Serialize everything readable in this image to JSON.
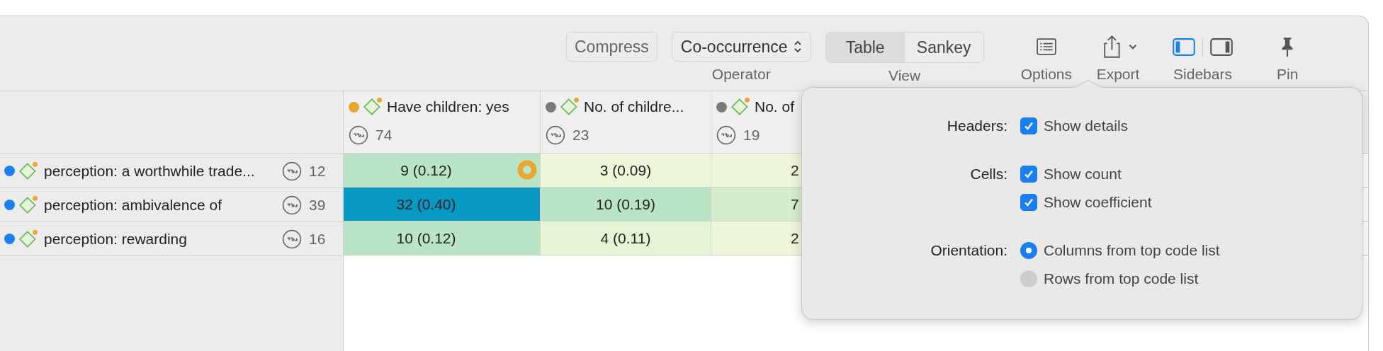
{
  "toolbar": {
    "compress": "Compress",
    "operator": {
      "value": "Co-occurrence",
      "label": "Operator"
    },
    "view": {
      "label": "View",
      "segments": [
        {
          "label": "Table",
          "selected": true
        },
        {
          "label": "Sankey",
          "selected": false
        }
      ]
    },
    "options": {
      "label": "Options"
    },
    "export": {
      "label": "Export"
    },
    "sidebars": {
      "label": "Sidebars",
      "left_on": true,
      "right_on": false
    },
    "pin": {
      "label": "Pin"
    }
  },
  "table": {
    "columns": [
      {
        "label": "Have children: yes",
        "color": "#e8a530",
        "count": "74"
      },
      {
        "label": "No. of childre...",
        "color": "#7a7a7a",
        "count": "23"
      },
      {
        "label": "No. of",
        "color": "#7a7a7a",
        "count": "19"
      }
    ],
    "rows": [
      {
        "label": "perception: a worthwhile trade...",
        "color": "#1a7ff0",
        "count": "12",
        "cells": [
          {
            "text": "9 (0.12)",
            "color": "#b9e4c5",
            "flagged": true
          },
          {
            "text": "3 (0.09)",
            "color": "#eef6d9",
            "flagged": false
          },
          {
            "text": "2",
            "color": "#eef6d9",
            "flagged": false
          }
        ]
      },
      {
        "label": "perception: ambivalence of",
        "color": "#1a7ff0",
        "count": "39",
        "cells": [
          {
            "text": "32 (0.40)",
            "color": "#0898c4",
            "flagged": false
          },
          {
            "text": "10 (0.19)",
            "color": "#b9e4c5",
            "flagged": false
          },
          {
            "text": "7",
            "color": "#d6edcc",
            "flagged": false
          }
        ]
      },
      {
        "label": "perception: rewarding",
        "color": "#1a7ff0",
        "count": "16",
        "cells": [
          {
            "text": "10 (0.12)",
            "color": "#b9e4c5",
            "flagged": false
          },
          {
            "text": "4 (0.11)",
            "color": "#e6f4d6",
            "flagged": false
          },
          {
            "text": "2",
            "color": "#eef6d9",
            "flagged": false
          }
        ]
      }
    ]
  },
  "options_popover": {
    "sections": [
      {
        "label": "Headers:",
        "items": [
          {
            "kind": "checkbox",
            "label": "Show details",
            "checked": true
          }
        ]
      },
      {
        "label": "Cells:",
        "items": [
          {
            "kind": "checkbox",
            "label": "Show count",
            "checked": true
          },
          {
            "kind": "checkbox",
            "label": "Show coefficient",
            "checked": true
          }
        ]
      },
      {
        "label": "Orientation:",
        "items": [
          {
            "kind": "radio",
            "label": "Columns from top code list",
            "selected": true
          },
          {
            "kind": "radio",
            "label": "Rows from top code list",
            "selected": false
          }
        ]
      }
    ]
  }
}
